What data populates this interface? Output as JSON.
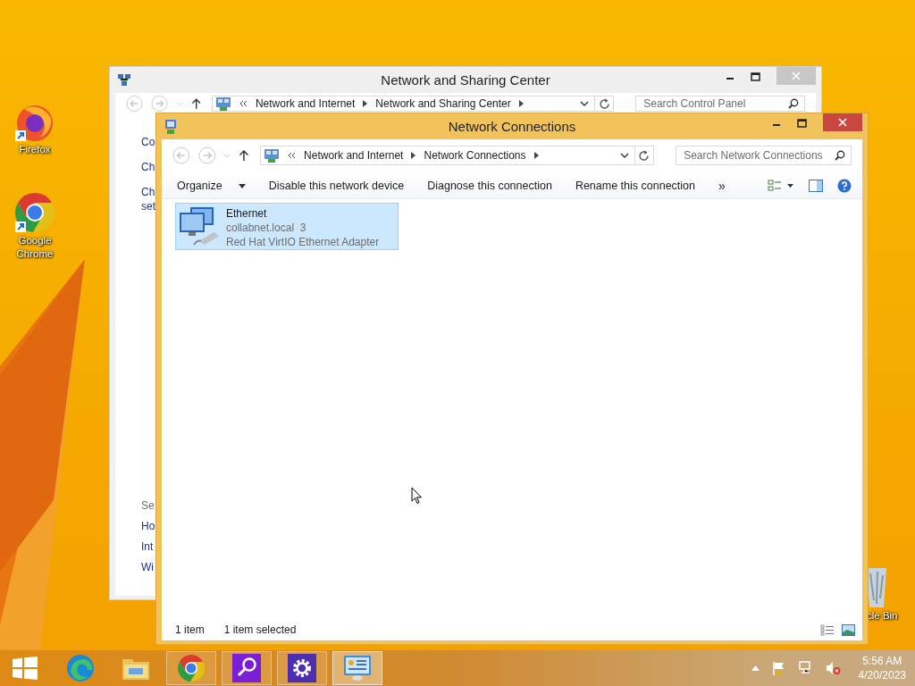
{
  "desktop_icons": [
    {
      "label": "Firefox",
      "kind": "firefox"
    },
    {
      "label": "Google Chrome",
      "kind": "chrome"
    },
    {
      "label": "cle Bin",
      "kind": "recycle"
    }
  ],
  "back_window": {
    "title": "Network and Sharing Center",
    "breadcrumb": [
      "Network and Internet",
      "Network and Sharing Center"
    ],
    "search": {
      "placeholder": "Search Control Panel"
    },
    "tasks": [
      [
        "Co"
      ],
      [
        "Ch"
      ],
      [
        "Ch",
        "set"
      ]
    ],
    "see_also": {
      "heading": "Se",
      "links": [
        "Ho",
        "Int",
        "Wi"
      ]
    }
  },
  "front_window": {
    "title": "Network Connections",
    "breadcrumb": [
      "Network and Internet",
      "Network Connections"
    ],
    "search": {
      "placeholder": "Search Network Connections"
    },
    "toolbar": [
      {
        "label": "Organize",
        "kind": "menu"
      },
      {
        "label": "Disable this network device",
        "kind": "command"
      },
      {
        "label": "Diagnose this connection",
        "kind": "command"
      },
      {
        "label": "Rename this connection",
        "kind": "command"
      },
      {
        "label": "»",
        "kind": "overflow"
      }
    ],
    "items": [
      {
        "name": "Ethernet",
        "network": "collabnet.local  3",
        "adapter": "Red Hat VirtIO Ethernet Adapter",
        "selected": true
      }
    ],
    "status_bar": {
      "count": "1 item",
      "selection": "1 item selected"
    }
  },
  "taskbar": {
    "apps": [
      {
        "kind": "edge",
        "running": false,
        "active": false
      },
      {
        "kind": "explorer",
        "running": false,
        "active": false
      },
      {
        "kind": "chrome",
        "running": true,
        "active": false
      },
      {
        "kind": "search",
        "running": true,
        "active": false
      },
      {
        "kind": "settings",
        "running": true,
        "active": false
      },
      {
        "kind": "control-panel",
        "running": true,
        "active": true
      }
    ],
    "time": "5:56 AM",
    "date": "4/20/2023"
  }
}
